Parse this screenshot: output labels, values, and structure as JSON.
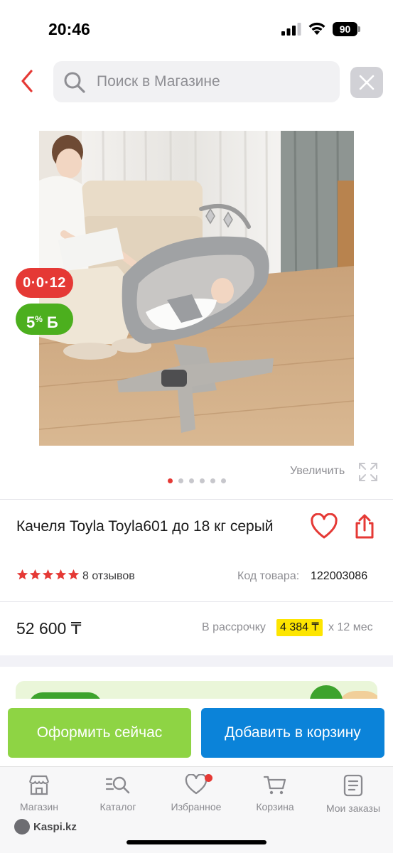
{
  "status": {
    "time": "20:46",
    "battery": "90"
  },
  "search": {
    "placeholder": "Поиск в Магазине"
  },
  "badges": {
    "installment": "0·0·12",
    "bonus": "5",
    "bonus_suffix": "%",
    "bonus_currency": "Б"
  },
  "gallery": {
    "enlarge": "Увеличить",
    "total_images": 6,
    "active_index": 0
  },
  "product": {
    "title": "Качеля Toyla Toyla601 до 18 кг серый",
    "rating": 5,
    "reviews": "8 отзывов",
    "code_label": "Код товара:",
    "code": "122003086",
    "price": "52 600 ₸",
    "installment_prefix": "В рассрочку",
    "installment_amount": "4 384 ₸",
    "installment_suffix": "х 12 мес"
  },
  "actions": {
    "checkout": "Оформить сейчас",
    "add_to_cart": "Добавить в корзину"
  },
  "tabbar": {
    "items": [
      {
        "label": "Магазин",
        "icon": "store-icon"
      },
      {
        "label": "Каталог",
        "icon": "catalog-search-icon"
      },
      {
        "label": "Избранное",
        "icon": "heart-icon"
      },
      {
        "label": "Корзина",
        "icon": "cart-icon"
      },
      {
        "label": "Мои заказы",
        "icon": "orders-icon"
      }
    ]
  },
  "brand": {
    "logo_text": "Kaspi.kz"
  },
  "colors": {
    "accent_red": "#e53935",
    "checkout_green": "#8ed444",
    "cart_blue": "#0b83d9",
    "installment_highlight": "#fde500",
    "bonus_green": "#4caf1e"
  }
}
